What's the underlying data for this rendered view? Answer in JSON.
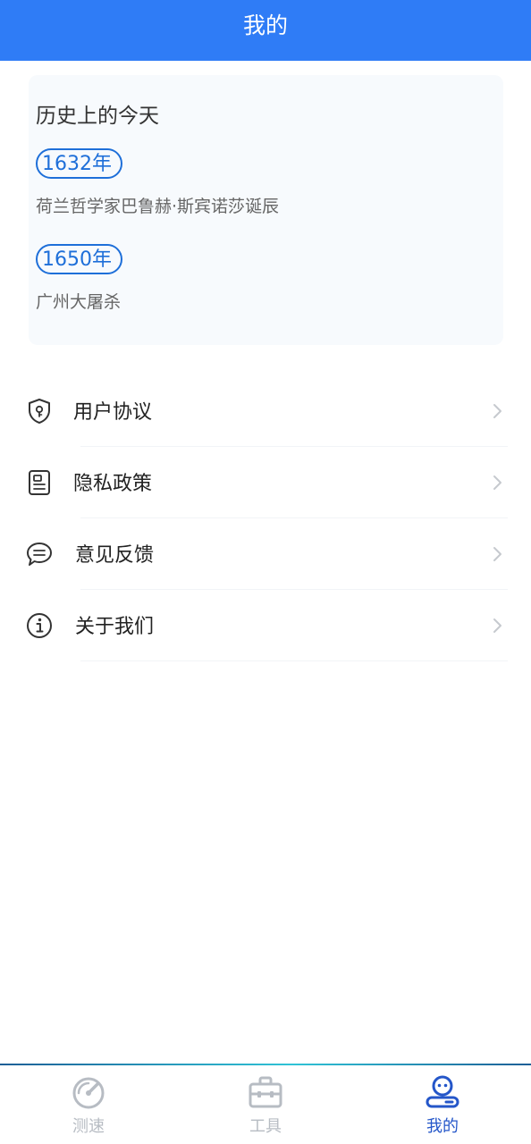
{
  "header": {
    "title": "我的"
  },
  "history_card": {
    "title": "历史上的今天",
    "events": [
      {
        "year": "1632年",
        "description": "荷兰哲学家巴鲁赫·斯宾诺莎诞辰"
      },
      {
        "year": "1650年",
        "description": "广州大屠杀"
      }
    ]
  },
  "menu": {
    "items": [
      {
        "label": "用户协议",
        "icon": "shield-lock-icon"
      },
      {
        "label": "隐私政策",
        "icon": "document-icon"
      },
      {
        "label": "意见反馈",
        "icon": "chat-bubble-icon"
      },
      {
        "label": "关于我们",
        "icon": "info-icon"
      }
    ]
  },
  "tabbar": {
    "tabs": [
      {
        "label": "测速",
        "icon": "speedometer-icon",
        "active": false
      },
      {
        "label": "工具",
        "icon": "toolbox-icon",
        "active": false
      },
      {
        "label": "我的",
        "icon": "profile-icon",
        "active": true
      }
    ]
  },
  "colors": {
    "header": "#2f7cf6",
    "accent": "#1e6fd9",
    "active_tab": "#2456c9",
    "inactive_tab": "#b7bcc3"
  }
}
